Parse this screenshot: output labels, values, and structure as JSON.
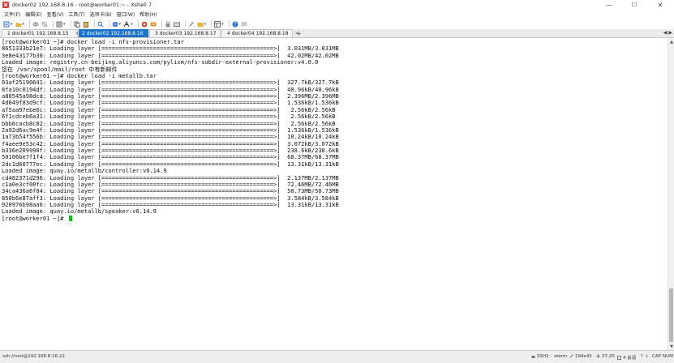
{
  "window": {
    "title": "docker02 192.168.8.16 - root@worker01:~ - Xshell 7",
    "controls": {
      "minimize": "—",
      "maximize": "☐",
      "close": "✕"
    }
  },
  "menu": [
    "文件(F)",
    "编辑(E)",
    "查看(V)",
    "工具(T)",
    "选项卡(B)",
    "窗口(W)",
    "帮助(H)"
  ],
  "toolbar": {
    "icons": [
      "new-session-icon",
      "open-folder-icon",
      "link-icon",
      "unlink-icon",
      "properties-icon",
      "copy-icon",
      "paste-icon",
      "find-icon",
      "globe-icon",
      "font-icon",
      "color-icon",
      "xftp-icon",
      "lock-icon",
      "keyboard-icon",
      "compose-icon",
      "transfer-icon",
      "layout-icon",
      "help-icon",
      "chat-icon"
    ],
    "colors": {
      "blue": "#2d6fd6",
      "green": "#2a9d3a",
      "orange": "#e68a1c",
      "red": "#d23b2b",
      "gray": "#8a8a8a"
    }
  },
  "tabs": [
    {
      "label": "1 docker01 192.168.8.15",
      "active": false
    },
    {
      "label": "2 docker02 192.168.8.16",
      "active": true
    },
    {
      "label": "3 docker03 192.168.8.17",
      "active": false
    },
    {
      "label": "4 docker04 192.168.8.18",
      "active": false
    }
  ],
  "tabbar": {
    "add": "+",
    "nav": "◀ ▶"
  },
  "terminal": {
    "cursor_color": "#00c800",
    "lines": [
      "[root@worker01 ~]# docker load -i nfs-provisioner.tar",
      "8651333b21e7: Loading layer [==================================================>]  3.031MB/3.031MB",
      "3e8e43177b30: Loading layer [==================================================>]  42.02MB/42.02MB",
      "Loaded image: registry.cn-beijing.aliyuncs.com/pylixm/nfs-subdir-external-provisioner:v4.0.0",
      "您在 /var/spool/mail/root 中有新邮件",
      "[root@worker01 ~]# docker load -i metallb.tar",
      "03af25190641: Loading layer [==================================================>]  327.7kB/327.7kB",
      "8fa10c0194df: Loading layer [==================================================>]  40.96kB/40.96kB",
      "a80545a98dcd: Loading layer [==================================================>]  2.396MB/2.396MB",
      "4d049f83d9cf: Loading layer [==================================================>]  1.536kB/1.536kB",
      "af5aa97ebe6c: Loading layer [==================================================>]   2.56kB/2.56kB",
      "6f1cdceb6a31: Loading layer [==================================================>]   2.56kB/2.56kB",
      "bbb6cacb8c82: Loading layer [==================================================>]   2.56kB/2.56kB",
      "2a92d6ac9e4f: Loading layer [==================================================>]  1.536kB/1.536kB",
      "1a73b54f556b: Loading layer [==================================================>]  10.24kB/10.24kB",
      "f4aee9e53c42: Loading layer [==================================================>]  3.072kB/3.072kB",
      "b336e209998f: Loading layer [==================================================>]  238.6kB/238.6kB",
      "50106be7f1f4: Loading layer [==================================================>]  68.37MB/68.37MB",
      "2dc1d60777ec: Loading layer [==================================================>]  13.31kB/13.31kB",
      "Loaded image: quay.io/metallb/controller:v0.14.9",
      "cd482371d296: Loading layer [==================================================>]  2.137MB/2.137MB",
      "c1a0e3cf00fc: Loading layer [==================================================>]  72.46MB/72.46MB",
      "34ca436a6f84: Loading layer [==================================================>]  50.73MB/50.73MB",
      "850b6e87aff3: Loading layer [==================================================>]  3.584kB/3.584kB",
      "920976b98aa6: Loading layer [==================================================>]  13.31kB/13.31kB",
      "Loaded image: quay.io/metallb/speaker:v0.14.9",
      "[root@worker01 ~]# "
    ]
  },
  "statusbar": {
    "connection": "ssh://root@192.168.8.16:22",
    "protocol": "SSH2",
    "terminal_type": "xterm",
    "size": "194x45",
    "cursor_pos": "27,20",
    "sessions": "4 会话",
    "cap": "CAP",
    "num": "NUM"
  }
}
